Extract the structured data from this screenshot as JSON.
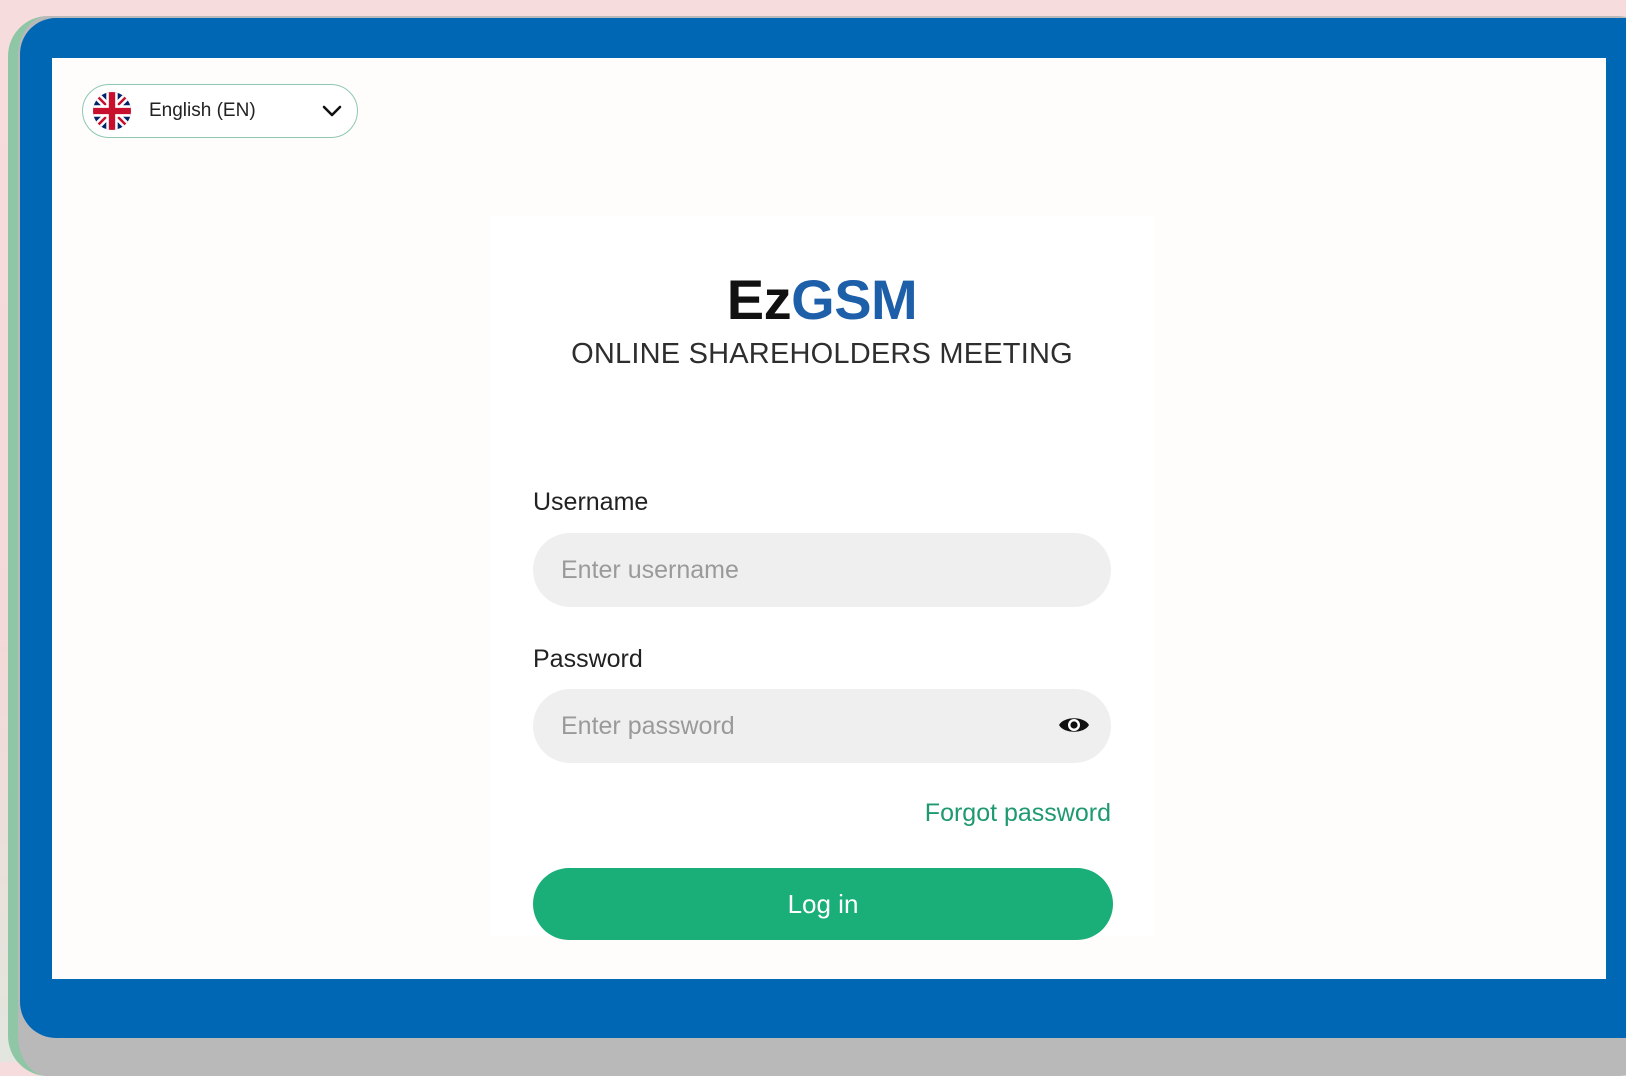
{
  "language_selector": {
    "flag_icon": "uk-flag-icon",
    "label": "English (EN)",
    "chevron_icon": "chevron-down-icon"
  },
  "brand": {
    "part1": "Ez",
    "part2": "GSM",
    "part1_color": "#111111",
    "part2_color": "#1d5fa8"
  },
  "subtitle": "ONLINE SHAREHOLDERS MEETING",
  "form": {
    "username_label": "Username",
    "username_placeholder": "Enter username",
    "password_label": "Password",
    "password_placeholder": "Enter password",
    "password_toggle_icon": "eye-icon",
    "forgot_password": "Forgot password",
    "login_button": "Log in"
  },
  "colors": {
    "frame": "#0067b5",
    "accent_green": "#1aae78",
    "link_green": "#1e9a6e"
  }
}
